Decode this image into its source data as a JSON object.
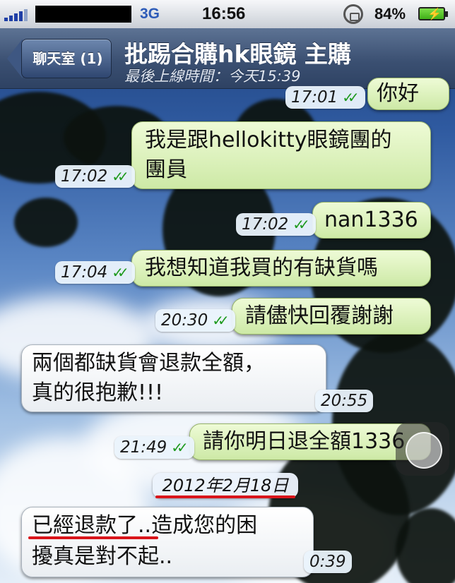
{
  "status_bar": {
    "network": "3G",
    "time": "16:56",
    "battery": "84%"
  },
  "nav": {
    "back_label": "聊天室 (1)",
    "title": "批踢合購hk眼鏡 主購",
    "subtitle": "最後上線時間：今天15:39"
  },
  "messages": [
    {
      "dir": "out",
      "time": "17:01",
      "lines": [
        "你好"
      ]
    },
    {
      "dir": "out",
      "time": "17:02",
      "lines": [
        "我是跟hellokitty眼鏡團的",
        "團員"
      ]
    },
    {
      "dir": "out",
      "time": "17:02",
      "lines": [
        "nan1336"
      ]
    },
    {
      "dir": "out",
      "time": "17:04",
      "lines": [
        "我想知道我買的有缺貨嗎"
      ]
    },
    {
      "dir": "out",
      "time": "20:30",
      "lines": [
        "請儘快回覆謝謝"
      ]
    },
    {
      "dir": "in",
      "time": "20:55",
      "lines": [
        "兩個都缺貨會退款全額，",
        "真的很抱歉!!!"
      ]
    },
    {
      "dir": "out",
      "time": "21:49",
      "lines": [
        "請你明日退全額1336"
      ]
    },
    {
      "dir": "in",
      "time": "0:39",
      "lines": [
        "已經退款了..造成您的困",
        "擾真是對不起.."
      ]
    }
  ],
  "date_divider": "2012年2月18日",
  "colors": {
    "outgoing_bubble": "#d9f0b8",
    "incoming_bubble": "#ffffff",
    "read_ticks": "#1e9a1e",
    "annotation_underline": "#d9151b",
    "navbar": "#3b5072"
  }
}
